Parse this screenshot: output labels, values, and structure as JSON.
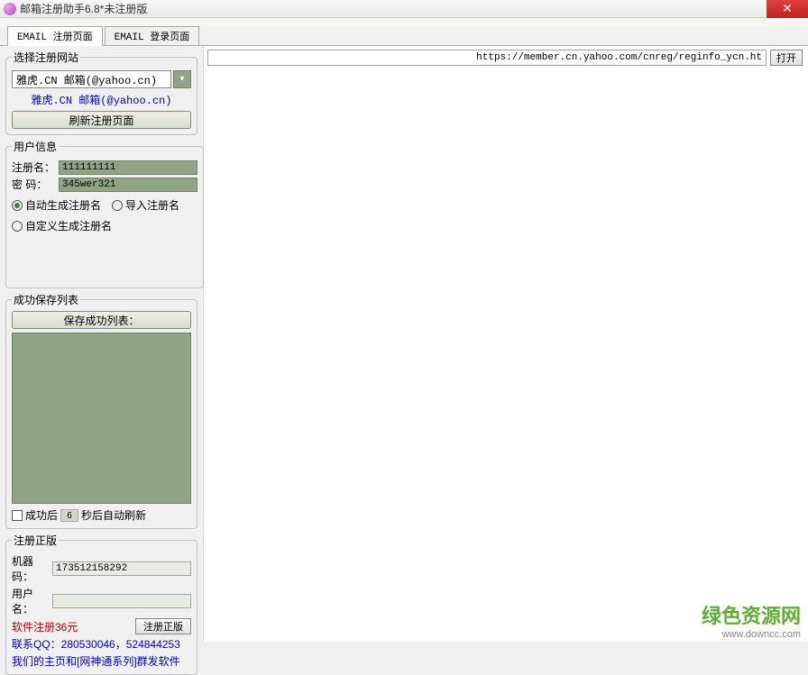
{
  "title": "邮箱注册助手6.8*未注册版",
  "close_icon": "✕",
  "tabs": {
    "register": "EMAIL 注册页面",
    "login": "EMAIL 登录页面"
  },
  "url": "https://member.cn.yahoo.com/cnreg/reginfo_ycn.ht",
  "open_btn": "打开",
  "site": {
    "legend": "选择注册网站",
    "selected": "雅虎.CN 邮箱(@yahoo.cn)",
    "dropdown_icon": "▾",
    "link": "雅虎.CN 邮箱(@yahoo.cn)",
    "refresh_btn": "刷新注册页面"
  },
  "user": {
    "legend": "用户信息",
    "name_label": "注册名：",
    "name_value": "111111111",
    "pwd_label": "密  码：",
    "pwd_value": "345wer321",
    "radio_auto": "自动生成注册名",
    "radio_import": "导入注册名",
    "radio_custom": "自定义生成注册名"
  },
  "savelist": {
    "legend": "成功保存列表",
    "header_btn": "保存成功列表：",
    "checkbox_label": "成功后",
    "seconds": "6",
    "after_label": "秒后自动刷新"
  },
  "register": {
    "legend": "注册正版",
    "machine_label": "机器码：",
    "machine_value": "173512158292",
    "user_label": "用户名：",
    "user_value": "",
    "price": "软件注册36元",
    "reg_btn": "注册正版",
    "contact": "联系QQ：280530046，524844253",
    "links": "我们的主页和[网神通系列]群发软件"
  },
  "watermark": {
    "top": "绿色资源网",
    "bot": "www.downcc.com"
  }
}
